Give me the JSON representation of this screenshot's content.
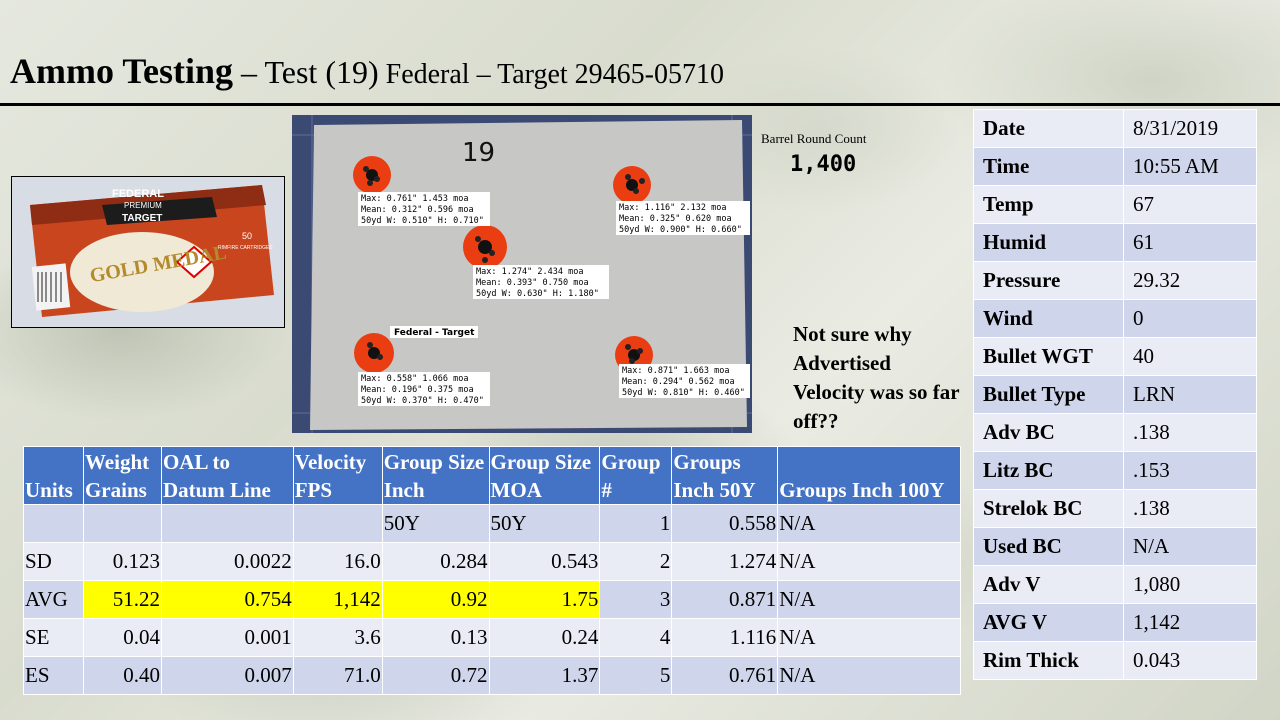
{
  "title": {
    "bold": "Ammo Testing",
    "sep1": " – ",
    "test": "Test (19)",
    "rest": " Federal – Target 29465-05710"
  },
  "barrel": {
    "label": "Barrel Round Count",
    "count": "1,400"
  },
  "note": "Not sure why Advertised Velocity was so far off??",
  "box_photo": {
    "brand": "FEDERAL",
    "sub": "PREMIUM",
    "type": "TARGET",
    "model": "GOLD MEDAL",
    "qty": "50",
    "qty_text": "RIMFIRE CARTRIDGES"
  },
  "target_photo": {
    "number": "19",
    "label": "Federal - Target",
    "groups": [
      {
        "lines": [
          "Max: 0.761\" 1.453 moa",
          "Mean: 0.312\" 0.596 moa",
          "50yd  W: 0.510\" H: 0.710\""
        ]
      },
      {
        "lines": [
          "Max: 1.116\" 2.132 moa",
          "Mean: 0.325\" 0.620 moa",
          "50yd  W: 0.900\" H: 0.660\""
        ]
      },
      {
        "lines": [
          "Max: 1.274\" 2.434 moa",
          "Mean: 0.393\" 0.750 moa",
          "50yd  W: 0.630\" H: 1.180\""
        ]
      },
      {
        "lines": [
          "Max: 0.558\" 1.066 moa",
          "Mean: 0.196\" 0.375 moa",
          "50yd  W: 0.370\" H: 0.470\""
        ]
      },
      {
        "lines": [
          "Max: 0.871\" 1.663 moa",
          "Mean: 0.294\" 0.562 moa",
          "50yd  W: 0.810\" H: 0.460\""
        ]
      }
    ]
  },
  "conditions": [
    {
      "key": "Date",
      "value": "8/31/2019"
    },
    {
      "key": "Time",
      "value": "10:55 AM"
    },
    {
      "key": "Temp",
      "value": "67"
    },
    {
      "key": "Humid",
      "value": "61"
    },
    {
      "key": "Pressure",
      "value": "29.32"
    },
    {
      "key": "Wind",
      "value": "0"
    },
    {
      "key": "Bullet WGT",
      "value": "40"
    },
    {
      "key": "Bullet Type",
      "value": "LRN"
    },
    {
      "key": "Adv BC",
      "value": ".138"
    },
    {
      "key": "Litz BC",
      "value": ".153"
    },
    {
      "key": "Strelok BC",
      "value": ".138"
    },
    {
      "key": "Used BC",
      "value": "N/A"
    },
    {
      "key": "Adv V",
      "value": "1,080"
    },
    {
      "key": "AVG V",
      "value": "1,142"
    },
    {
      "key": "Rim Thick",
      "value": "0.043"
    }
  ],
  "table": {
    "headers": [
      "Units",
      "Weight Grains",
      "OAL to Datum Line",
      "Velocity FPS",
      "Group Size Inch",
      "Group Size MOA",
      "Group #",
      "Groups Inch 50Y",
      "Groups  Inch 100Y"
    ],
    "rows": [
      [
        "",
        "",
        "",
        "",
        "50Y",
        "50Y",
        "1",
        "0.558",
        "N/A"
      ],
      [
        "SD",
        "0.123",
        "0.0022",
        "16.0",
        "0.284",
        "0.543",
        "2",
        "1.274",
        "N/A"
      ],
      [
        "AVG",
        "51.22",
        "0.754",
        "1,142",
        "0.92",
        "1.75",
        "3",
        "0.871",
        "N/A"
      ],
      [
        "SE",
        "0.04",
        "0.001",
        "3.6",
        "0.13",
        "0.24",
        "4",
        "1.116",
        "N/A"
      ],
      [
        "ES",
        "0.40",
        "0.007",
        "71.0",
        "0.72",
        "1.37",
        "5",
        "0.761",
        "N/A"
      ]
    ]
  },
  "colors": {
    "header": "#4472c4",
    "highlight": "#ffff00",
    "row_dark": "#cfd5ea",
    "row_light": "#e9ebf5"
  }
}
